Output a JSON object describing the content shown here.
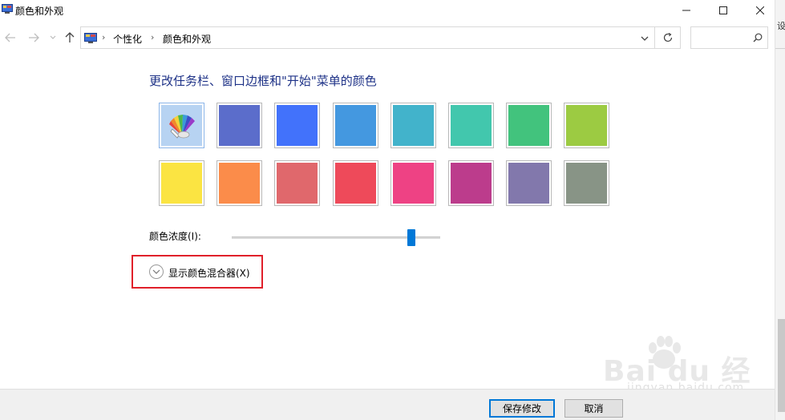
{
  "window": {
    "title": "颜色和外观",
    "right_edge_fragment": "设"
  },
  "addressbar": {
    "crumbs": [
      "个性化",
      "颜色和外观"
    ],
    "separator": "›"
  },
  "search": {
    "placeholder": ""
  },
  "content": {
    "heading": "更改任务栏、窗口边框和\"开始\"菜单的颜色",
    "swatches": [
      {
        "name": "automatic",
        "color": "#b7d3f2",
        "selected": true
      },
      {
        "name": "slate-blue",
        "color": "#5b6dcb"
      },
      {
        "name": "blue",
        "color": "#4272fb"
      },
      {
        "name": "sky-blue",
        "color": "#4498e0"
      },
      {
        "name": "teal",
        "color": "#42b3cb"
      },
      {
        "name": "sea-green",
        "color": "#42c7ad"
      },
      {
        "name": "green",
        "color": "#42c37d"
      },
      {
        "name": "lime",
        "color": "#9ccb42"
      },
      {
        "name": "yellow",
        "color": "#fbe442"
      },
      {
        "name": "orange",
        "color": "#fb8c4a"
      },
      {
        "name": "salmon",
        "color": "#e0686c"
      },
      {
        "name": "red",
        "color": "#ee4a5a"
      },
      {
        "name": "pink",
        "color": "#ee4284"
      },
      {
        "name": "magenta",
        "color": "#bc3c8c"
      },
      {
        "name": "purple",
        "color": "#8278ac"
      },
      {
        "name": "gray-green",
        "color": "#889486"
      }
    ],
    "intensity_label": "颜色浓度(I):",
    "intensity_value_pct": 86,
    "mixer_label": "显示颜色混合器(X)"
  },
  "buttons": {
    "save": "保存修改",
    "cancel": "取消"
  },
  "watermark": {
    "main": "Bai du 经验",
    "sub": "jingyan.baidu.com"
  },
  "colors": {
    "accent": "#0078d7",
    "heading": "#1e3287",
    "highlight_box": "#e0202a"
  }
}
